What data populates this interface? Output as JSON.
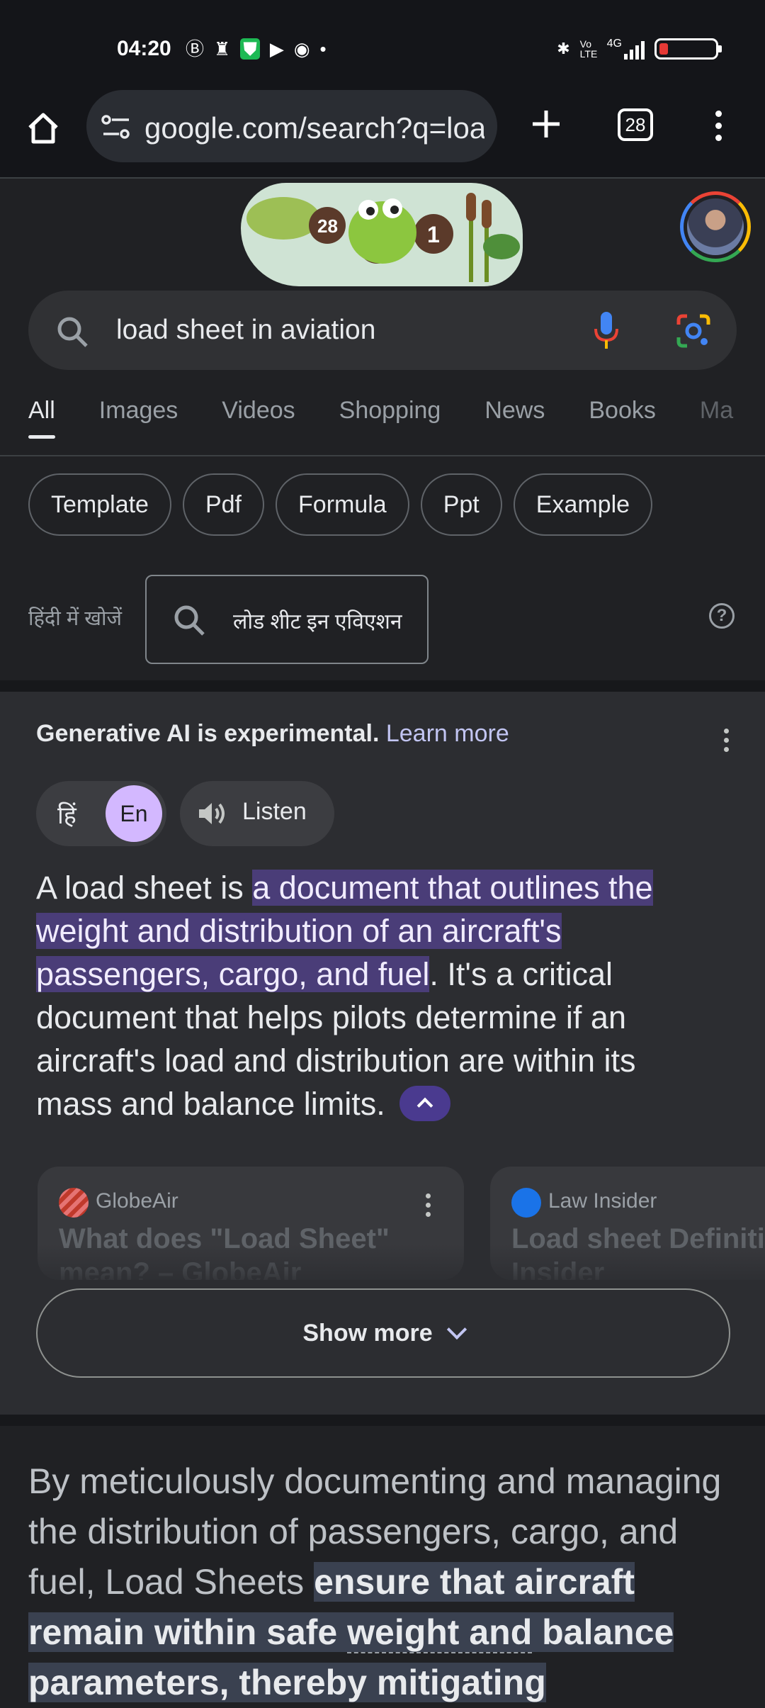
{
  "status_bar": {
    "time": "04:20",
    "left_icons": [
      "b-circle-icon",
      "robot-icon",
      "shield-icon",
      "play-icon",
      "chrome-icon",
      "dot-icon"
    ],
    "right_icons": [
      "bluetooth-icon",
      "volte-icon",
      "4g-signal-icon",
      "battery-icon"
    ],
    "network_label": "4G",
    "volte_label": "Vo LTE"
  },
  "browser": {
    "url": "google.com/search?q=load",
    "tab_count": "28"
  },
  "search": {
    "query": "load sheet in aviation"
  },
  "tabs": [
    "All",
    "Images",
    "Videos",
    "Shopping",
    "News",
    "Books",
    "Ma"
  ],
  "chips": [
    "Template",
    "Pdf",
    "Formula",
    "Ppt",
    "Example"
  ],
  "hindi_search": {
    "label": "हिंदी में खोजें",
    "query": "लोड शीट इन एविएशन",
    "help": "?"
  },
  "ai_overview": {
    "disclaimer": "Generative AI is experimental.",
    "learn_more": "Learn more",
    "lang_hi": "हिं",
    "lang_en": "En",
    "listen": "Listen",
    "text_1": "A load sheet is ",
    "text_highlight": "a document that outlines the weight and distribution of an aircraft's passengers, cargo, and fuel",
    "text_2": ". It's a critical document that helps pilots determine if an aircraft's load and distribution are within its mass and balance limits.",
    "sources": [
      {
        "site": "GlobeAir",
        "title": "What does \"Load Sheet\" mean? – GlobeAir"
      },
      {
        "site": "Law Insider",
        "title": "Load sheet Definition | Law Insider"
      }
    ],
    "show_more": "Show more"
  },
  "snippet": {
    "text_1": "By meticulously documenting and managing the distribution of passengers, cargo, and fuel, Load Sheets ",
    "highlight_1": "ensure that aircraft remain within safe ",
    "highlight_ul": "weight and",
    "highlight_2": " balance parameters, thereby mitigating"
  },
  "colors": {
    "background": "#202124",
    "ai_panel": "#2c2d31",
    "highlight": "#4a3d78",
    "accent_purple": "#d3b8ff"
  }
}
